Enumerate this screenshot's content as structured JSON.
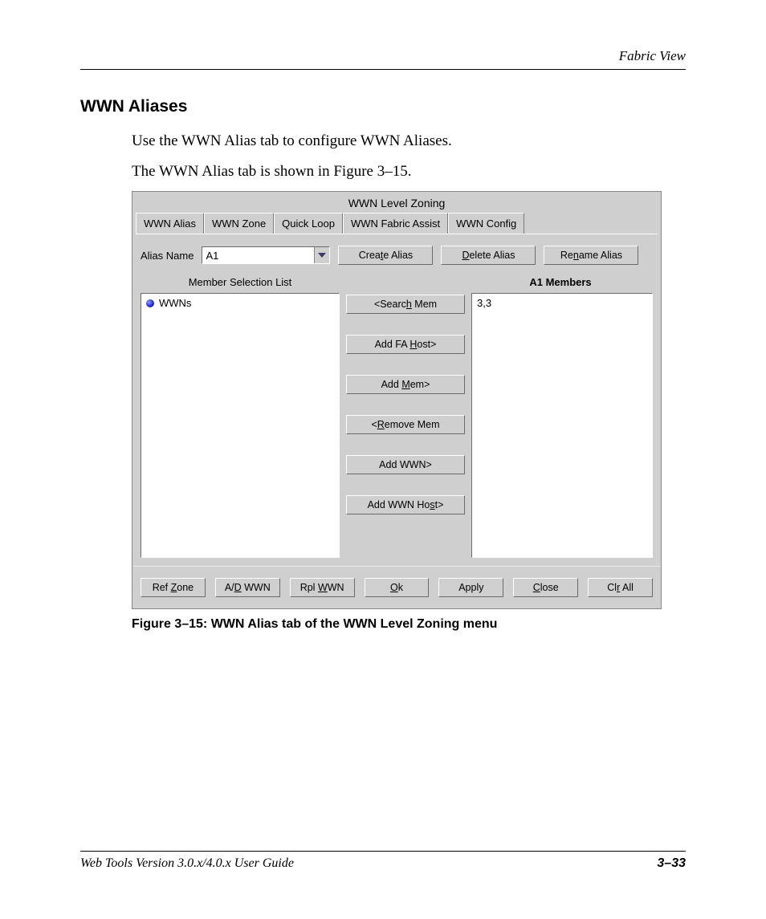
{
  "header": {
    "running": "Fabric View"
  },
  "section": {
    "heading": "WWN Aliases",
    "p1": "Use the WWN Alias tab to configure WWN Aliases.",
    "p2": "The WWN Alias tab is shown in Figure 3–15."
  },
  "dialog": {
    "title": "WWN Level Zoning",
    "tabs": [
      "WWN Alias",
      "WWN Zone",
      "Quick Loop",
      "WWN Fabric Assist",
      "WWN Config"
    ],
    "active_tab_index": 0,
    "alias_label": "Alias Name",
    "alias_value": "A1",
    "buttons_top": {
      "create": "Create Alias",
      "delete": "Delete Alias",
      "rename": "Rename Alias"
    },
    "list_headers": {
      "left": "Member Selection List",
      "right": "A1 Members"
    },
    "left_list": {
      "root": "WWNs"
    },
    "center_buttons": {
      "search": "<Search Mem",
      "add_fa_host": "Add FA Host>",
      "add_mem": "Add Mem>",
      "remove_mem": "<Remove Mem",
      "add_wwn": "Add WWN>",
      "add_wwn_host": "Add WWN Host>"
    },
    "right_list": {
      "item0": "3,3"
    },
    "bottom_buttons": {
      "ref_zone": "Ref Zone",
      "ad_wwn": "A/D WWN",
      "rpl_wwn": "Rpl WWN",
      "ok": "Ok",
      "apply": "Apply",
      "close": "Close",
      "clr_all": "Clr All"
    }
  },
  "caption": "Figure 3–15:  WWN Alias tab of the WWN Level Zoning menu",
  "footer": {
    "left": "Web Tools Version 3.0.x/4.0.x User Guide",
    "right": "3–33"
  }
}
